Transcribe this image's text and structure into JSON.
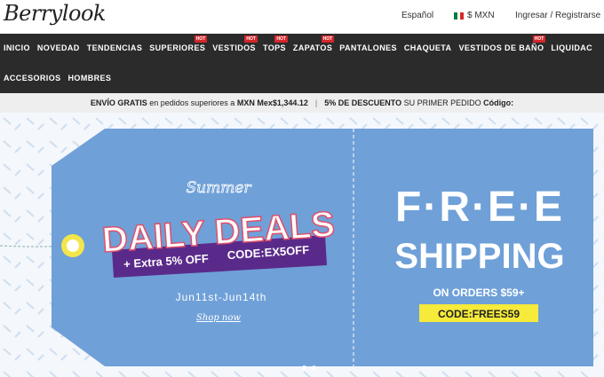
{
  "header": {
    "logo": "Berrylook",
    "language": "Español",
    "currency": "$ MXN",
    "account": "Ingresar / Registrarse"
  },
  "nav": {
    "row1": [
      {
        "label": "INICIO",
        "hot": false
      },
      {
        "label": "NOVEDAD",
        "hot": false
      },
      {
        "label": "TENDENCIAS",
        "hot": false
      },
      {
        "label": "SUPERIORES",
        "hot": true
      },
      {
        "label": "VESTIDOS",
        "hot": true
      },
      {
        "label": "TOPS",
        "hot": true
      },
      {
        "label": "ZAPATOS",
        "hot": true
      },
      {
        "label": "PANTALONES",
        "hot": false
      },
      {
        "label": "CHAQUETA",
        "hot": false
      },
      {
        "label": "VESTIDOS DE BAÑO",
        "hot": true
      },
      {
        "label": "LIQUIDAC",
        "hot": false
      }
    ],
    "row2": [
      {
        "label": "ACCESORIOS",
        "hot": false
      },
      {
        "label": "HOMBRES",
        "hot": false
      }
    ],
    "hot_label": "HOT"
  },
  "promo": {
    "free_ship_bold": "ENVÍO GRATIS",
    "free_ship_text": "en pedidos superiores a",
    "free_ship_amount": "MXN Mex$1,344.12",
    "separator": "|",
    "discount_bold": "5% DE DESCUENTO",
    "discount_text": "SU PRIMER PEDIDO",
    "code_label": "Código:"
  },
  "banner": {
    "summer": "Summer",
    "daily_deals": "DAILY DEALS",
    "extra_off": "+ Extra 5% OFF",
    "deal_code": "CODE:EX5OFF",
    "dates": "Jun11st-Jun14th",
    "shop_now": "Shop now",
    "free": "F·R·E·E",
    "shipping": "SHIPPING",
    "orders": "ON ORDERS $59+",
    "ship_code": "CODE:FREES59"
  },
  "colors": {
    "nav_bg": "#2b2b2b",
    "tag_blue": "#6fa0d8",
    "purple": "#5a2a8a",
    "pink": "#e0506a",
    "yellow": "#f6ea3a"
  }
}
